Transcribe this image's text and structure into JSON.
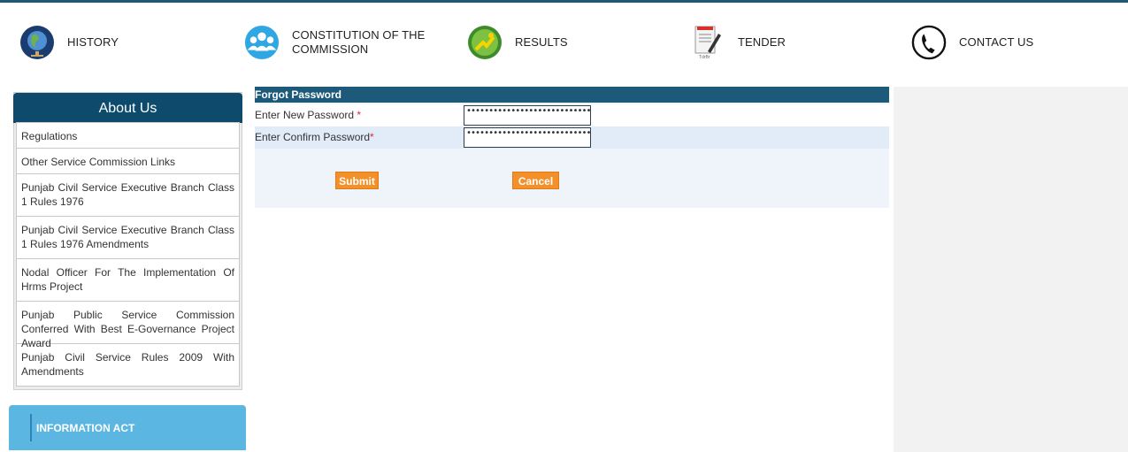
{
  "nav": {
    "items": [
      {
        "label": "HISTORY",
        "icon": "globe-icon"
      },
      {
        "label": "CONSTITUTION OF THE COMMISSION",
        "line1": "CONSTITUTION OF THE",
        "line2": "COMMISSION",
        "icon": "people-icon"
      },
      {
        "label": "RESULTS",
        "icon": "results-icon"
      },
      {
        "label": "TENDER",
        "icon": "document-pen-icon"
      },
      {
        "label": "CONTACT US",
        "icon": "phone-icon"
      }
    ]
  },
  "sidebar": {
    "title": "About Us",
    "items": [
      {
        "label": "Regulations"
      },
      {
        "label": "Other Service Commission Links"
      },
      {
        "label": "Punjab Civil Service Executive Branch Class 1 Rules 1976"
      },
      {
        "label": "Punjab Civil Service Executive Branch Class 1 Rules 1976 Amendments"
      },
      {
        "label": "Nodal Officer For The Implementation Of Hrms Project"
      },
      {
        "label": "Punjab Public Service Commission Conferred With Best E-Governance Project Award"
      },
      {
        "label": "Punjab Civil Service Rules 2009 With Amendments"
      }
    ],
    "information_act": "INFORMATION ACT"
  },
  "form": {
    "title": "Forgot Password",
    "new_password_label": "Enter New Password",
    "confirm_password_label": "Enter Confirm Password",
    "required_marker": "*",
    "new_password_value": "••••••••••••••••••••••••••••••••••",
    "confirm_password_value": "••••••••••••••••••••••••••••••••••",
    "submit_label": "Submit",
    "cancel_label": "Cancel"
  },
  "colors": {
    "header_blue": "#1d5a7a",
    "about_blue": "#0e4a6b",
    "button_orange": "#f4902a",
    "info_act_blue": "#5bb6e2",
    "required_red": "#d9302c"
  }
}
